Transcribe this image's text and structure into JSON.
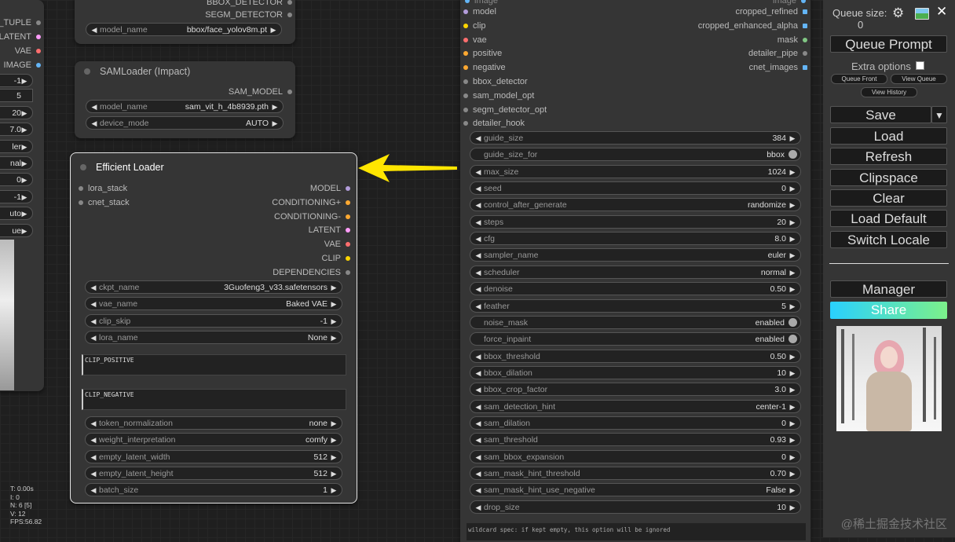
{
  "left_partial": {
    "outputs": [
      "_TUPLE",
      "LATENT",
      "VAE",
      "IMAGE"
    ],
    "output_colors": [
      "#888888",
      "#ff9cf9",
      "#ff6e6e",
      "#64b5f6"
    ],
    "widget_values": [
      "-1",
      "5",
      "20",
      "7.0",
      "ler",
      "nal",
      "0",
      "-1",
      "uto",
      "ue"
    ],
    "stats": [
      "T: 0.00s",
      "I: 0",
      "N: 6 [5]",
      "V: 12",
      "FPS:56.82"
    ]
  },
  "detector_node": {
    "outputs": [
      "BBOX_DETECTOR",
      "SEGM_DETECTOR"
    ],
    "widget": {
      "label": "model_name",
      "value": "bbox/face_yolov8m.pt"
    }
  },
  "sam_node": {
    "title": "SAMLoader (Impact)",
    "output": "SAM_MODEL",
    "widgets": [
      {
        "label": "model_name",
        "value": "sam_vit_h_4b8939.pth"
      },
      {
        "label": "device_mode",
        "value": "AUTO"
      }
    ]
  },
  "efficient_node": {
    "title": "Efficient Loader",
    "inputs": [
      "lora_stack",
      "cnet_stack"
    ],
    "outputs": [
      {
        "label": "MODEL",
        "color": "#b39ddb"
      },
      {
        "label": "CONDITIONING+",
        "color": "#ffa931"
      },
      {
        "label": "CONDITIONING-",
        "color": "#ffa931"
      },
      {
        "label": "LATENT",
        "color": "#ff9cf9"
      },
      {
        "label": "VAE",
        "color": "#ff6e6e"
      },
      {
        "label": "CLIP",
        "color": "#ffd500"
      },
      {
        "label": "DEPENDENCIES",
        "color": "#888888"
      }
    ],
    "widgets_top": [
      {
        "label": "ckpt_name",
        "value": "3Guofeng3_v33.safetensors"
      },
      {
        "label": "vae_name",
        "value": "Baked VAE"
      },
      {
        "label": "clip_skip",
        "value": "-1"
      },
      {
        "label": "lora_name",
        "value": "None"
      }
    ],
    "clip_positive": "CLIP_POSITIVE",
    "clip_negative": "CLIP_NEGATIVE",
    "widgets_bottom": [
      {
        "label": "token_normalization",
        "value": "none"
      },
      {
        "label": "weight_interpretation",
        "value": "comfy"
      },
      {
        "label": "empty_latent_width",
        "value": "512"
      },
      {
        "label": "empty_latent_height",
        "value": "512"
      },
      {
        "label": "batch_size",
        "value": "1"
      }
    ]
  },
  "detailer_node": {
    "top_partial_input": "image",
    "top_partial_output": "image",
    "inputs": [
      {
        "label": "model",
        "color": "#b39ddb"
      },
      {
        "label": "clip",
        "color": "#ffd500"
      },
      {
        "label": "vae",
        "color": "#ff6e6e"
      },
      {
        "label": "positive",
        "color": "#ffa931"
      },
      {
        "label": "negative",
        "color": "#ffa931"
      },
      {
        "label": "bbox_detector",
        "color": "#888888"
      },
      {
        "label": "sam_model_opt",
        "color": "#888888"
      },
      {
        "label": "segm_detector_opt",
        "color": "#888888"
      },
      {
        "label": "detailer_hook",
        "color": "#888888"
      }
    ],
    "outputs": [
      {
        "label": "cropped_refined",
        "color": "#64b5f6",
        "grid": true
      },
      {
        "label": "cropped_enhanced_alpha",
        "color": "#64b5f6",
        "grid": true
      },
      {
        "label": "mask",
        "color": "#81c784",
        "grid": false
      },
      {
        "label": "detailer_pipe",
        "color": "#888888",
        "grid": false
      },
      {
        "label": "cnet_images",
        "color": "#64b5f6",
        "grid": true
      }
    ],
    "widgets": [
      {
        "label": "guide_size",
        "value": "384",
        "toggle": false
      },
      {
        "label": "guide_size_for",
        "value": "bbox",
        "toggle": true
      },
      {
        "label": "max_size",
        "value": "1024",
        "toggle": false
      },
      {
        "label": "seed",
        "value": "0",
        "toggle": false
      },
      {
        "label": "control_after_generate",
        "value": "randomize",
        "toggle": false
      },
      {
        "label": "steps",
        "value": "20",
        "toggle": false
      },
      {
        "label": "cfg",
        "value": "8.0",
        "toggle": false
      },
      {
        "label": "sampler_name",
        "value": "euler",
        "toggle": false
      },
      {
        "label": "scheduler",
        "value": "normal",
        "toggle": false
      },
      {
        "label": "denoise",
        "value": "0.50",
        "toggle": false
      },
      {
        "label": "feather",
        "value": "5",
        "toggle": false
      },
      {
        "label": "noise_mask",
        "value": "enabled",
        "toggle": true
      },
      {
        "label": "force_inpaint",
        "value": "enabled",
        "toggle": true
      },
      {
        "label": "bbox_threshold",
        "value": "0.50",
        "toggle": false
      },
      {
        "label": "bbox_dilation",
        "value": "10",
        "toggle": false
      },
      {
        "label": "bbox_crop_factor",
        "value": "3.0",
        "toggle": false
      },
      {
        "label": "sam_detection_hint",
        "value": "center-1",
        "toggle": false
      },
      {
        "label": "sam_dilation",
        "value": "0",
        "toggle": false
      },
      {
        "label": "sam_threshold",
        "value": "0.93",
        "toggle": false
      },
      {
        "label": "sam_bbox_expansion",
        "value": "0",
        "toggle": false
      },
      {
        "label": "sam_mask_hint_threshold",
        "value": "0.70",
        "toggle": false
      },
      {
        "label": "sam_mask_hint_use_negative",
        "value": "False",
        "toggle": false
      },
      {
        "label": "drop_size",
        "value": "10",
        "toggle": false
      }
    ],
    "wildcard_text": "wildcard spec: if kept empty, this option will be ignored"
  },
  "sidebar": {
    "queue_size_label": "Queue size:",
    "queue_size_value": "0",
    "queue_prompt": "Queue Prompt",
    "extra_options": "Extra options",
    "queue_front": "Queue Front",
    "view_queue": "View Queue",
    "view_history": "View History",
    "save": "Save",
    "load": "Load",
    "refresh": "Refresh",
    "clipspace": "Clipspace",
    "clear": "Clear",
    "load_default": "Load Default",
    "switch_locale": "Switch Locale",
    "manager": "Manager",
    "share": "Share"
  },
  "watermark": "@稀土掘金技术社区",
  "colors": {
    "accent_arrow": "#ffe600",
    "share_gradient_start": "#29d0ff",
    "share_gradient_end": "#7cf08a"
  }
}
